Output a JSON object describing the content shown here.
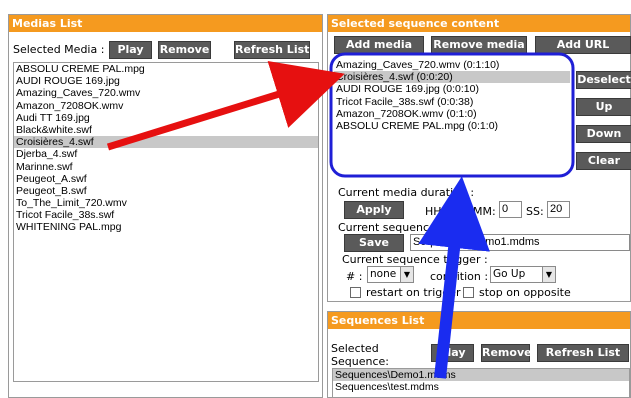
{
  "colors": {
    "header_orange": "#f59a1f",
    "button_gray": "#5a5a5a",
    "highlight_blue": "#1f1fd6",
    "arrow_red": "#e61010",
    "arrow_blue": "#1a2cf0"
  },
  "medias": {
    "title": "Medias List",
    "selected_label": "Selected Media :",
    "play": "Play",
    "remove": "Remove",
    "refresh": "Refresh List",
    "items": [
      "ABSOLU CREME PAL.mpg",
      "AUDI ROUGE 169.jpg",
      "Amazing_Caves_720.wmv",
      "Amazon_7208OK.wmv",
      "Audi TT 169.jpg",
      "Black&white.swf",
      "Croisières_4.swf",
      "Djerba_4.swf",
      "Marinne.swf",
      "Peugeot_A.swf",
      "Peugeot_B.swf",
      "To_The_Limit_720.wmv",
      "Tricot Facile_38s.swf",
      "WHITENING PAL.mpg"
    ],
    "selected_index": 6
  },
  "sequence": {
    "title": "Selected sequence content",
    "add_media": "Add media",
    "remove_media": "Remove media",
    "add_url": "Add URL",
    "items": [
      "Amazing_Caves_720.wmv (0:1:10)",
      "Croisières_4.swf (0:0:20)",
      "AUDI ROUGE 169.jpg (0:0:10)",
      "Tricot Facile_38s.swf (0:0:38)",
      "Amazon_7208OK.wmv (0:1:0)",
      "ABSOLU CREME PAL.mpg (0:1:0)"
    ],
    "selected_index": 1,
    "deselect": "Deselect",
    "up": "Up",
    "down": "Down",
    "clear": "Clear",
    "duration_label": "Current media duration :",
    "apply": "Apply",
    "hh_label": "HH:",
    "hh_value": "",
    "mm_label": "MM:",
    "mm_value": "0",
    "ss_label": "SS:",
    "ss_value": "20",
    "name_label": "Current sequence name :",
    "save": "Save",
    "path_value": "Sequences\\Demo1.mdms",
    "trigger_label": "Current sequence trigger :",
    "hash_label": "# :",
    "hash_value": "none",
    "condition_label": "condition :",
    "condition_value": "Go Up",
    "restart_label": "restart on trigger",
    "stop_label": "stop on opposite"
  },
  "sequences": {
    "title": "Sequences List",
    "selected_label_1": "Selected",
    "selected_label_2": "Sequence:",
    "play": "Play",
    "remove": "Remove",
    "refresh": "Refresh List",
    "items": [
      "Sequences\\Demo1.mdms",
      "Sequences\\test.mdms"
    ],
    "selected_index": 0
  }
}
